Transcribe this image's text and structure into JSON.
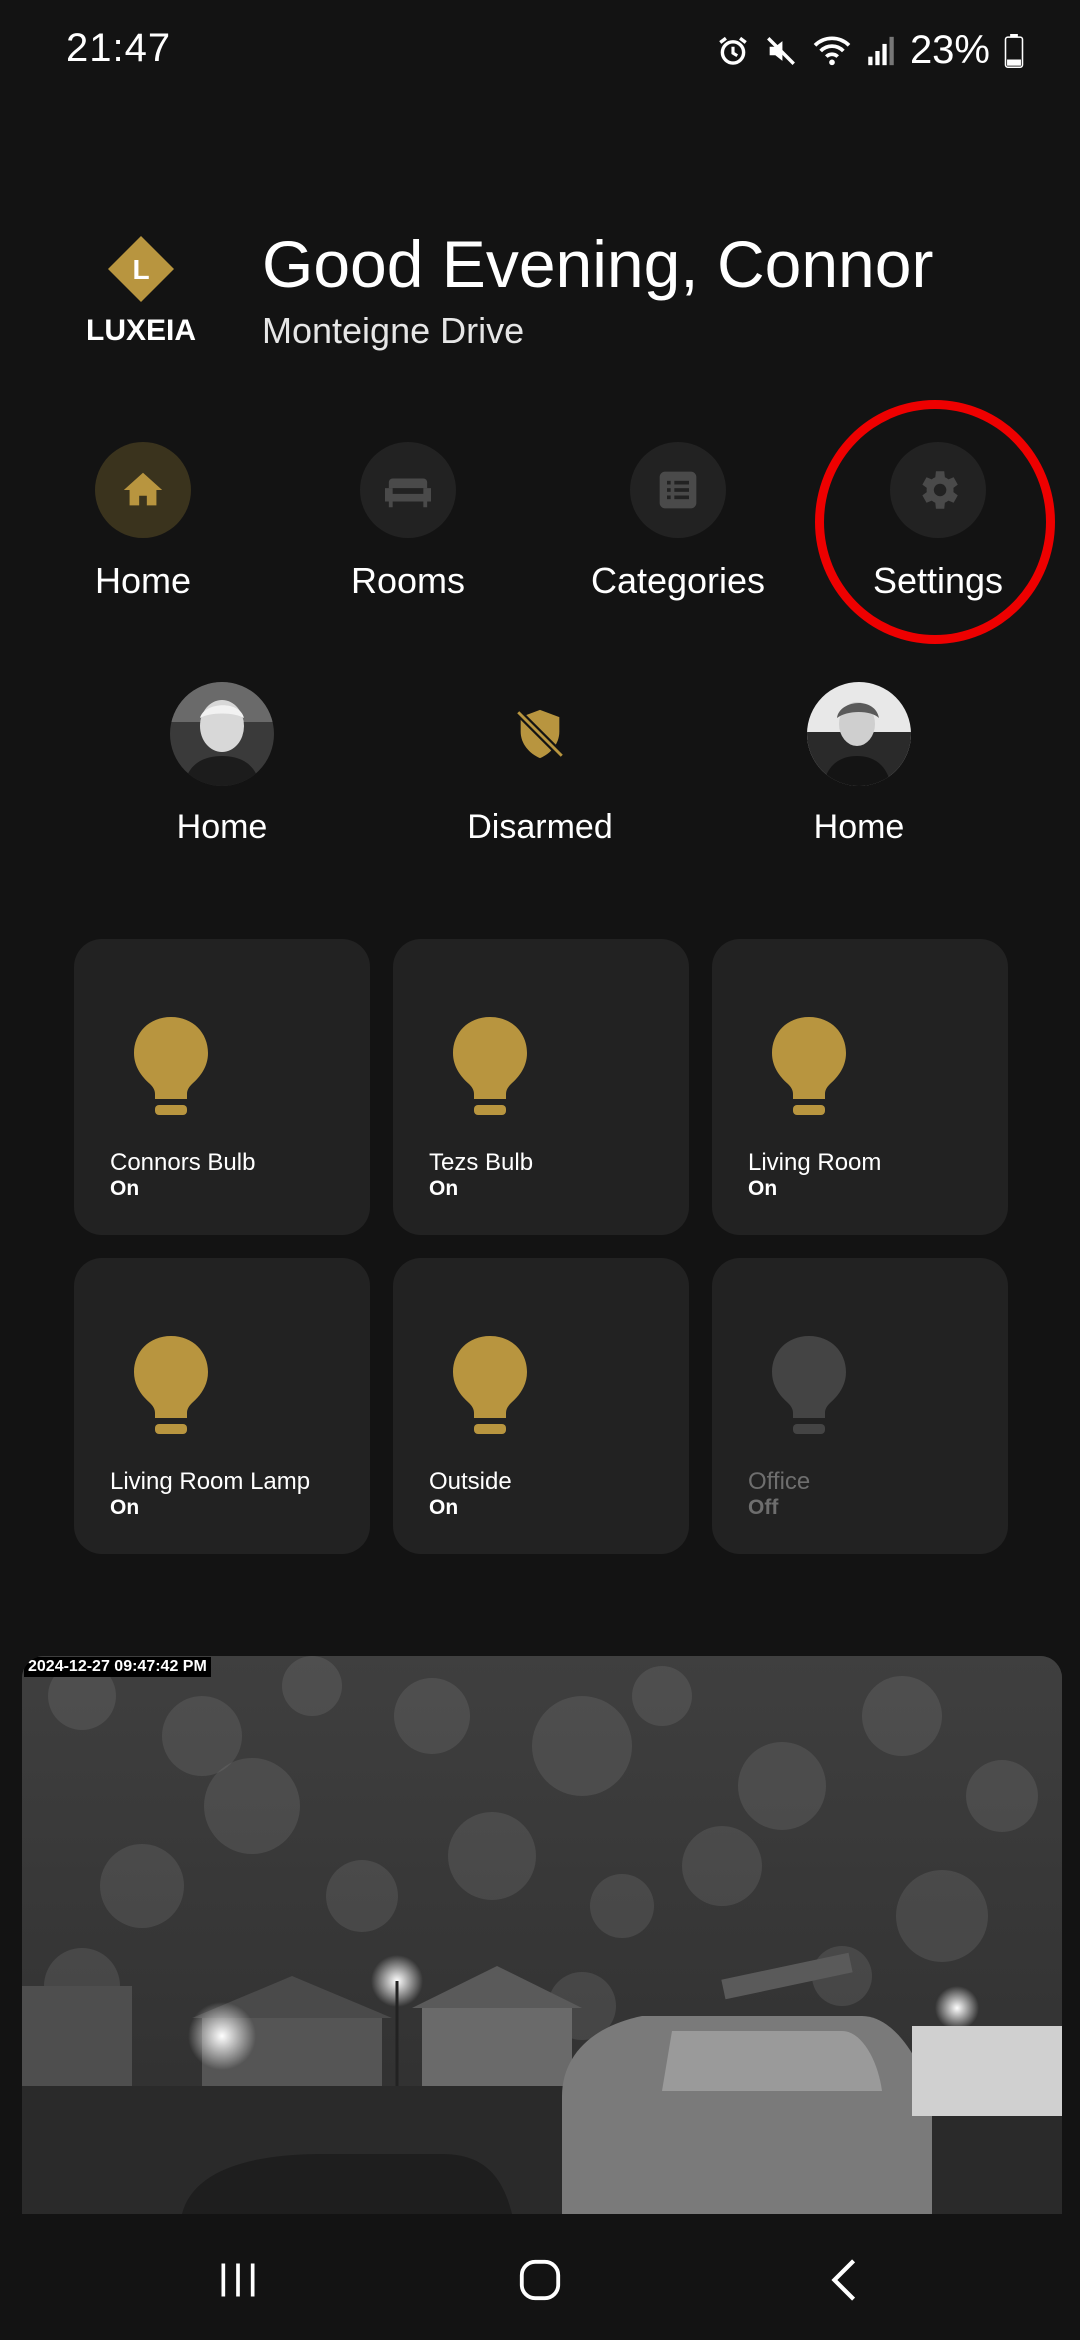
{
  "status_bar": {
    "time": "21:47",
    "battery": "23%",
    "icons": [
      "alarm-icon",
      "mute-icon",
      "wifi-icon",
      "signal-icon",
      "battery-icon"
    ]
  },
  "header": {
    "brand": "LUXEIA",
    "logo_letter": "L",
    "greeting": "Good Evening, Connor",
    "address": "Monteigne Drive"
  },
  "nav": {
    "items": [
      {
        "label": "Home",
        "icon": "home-icon",
        "active": true
      },
      {
        "label": "Rooms",
        "icon": "sofa-icon",
        "active": false
      },
      {
        "label": "Categories",
        "icon": "list-icon",
        "active": false
      },
      {
        "label": "Settings",
        "icon": "gear-icon",
        "active": false
      }
    ]
  },
  "presence": [
    {
      "label": "Home",
      "type": "person"
    },
    {
      "label": "Disarmed",
      "type": "alarm",
      "icon": "shield-off-icon"
    },
    {
      "label": "Home",
      "type": "person"
    }
  ],
  "lights": [
    {
      "name": "Connors Bulb",
      "state": "On"
    },
    {
      "name": "Tezs Bulb",
      "state": "On"
    },
    {
      "name": "Living Room",
      "state": "On"
    },
    {
      "name": "Living Room Lamp",
      "state": "On"
    },
    {
      "name": "Outside",
      "state": "On"
    },
    {
      "name": "Office",
      "state": "Off"
    }
  ],
  "camera": {
    "timestamp": "2024-12-27 09:47:42 PM"
  },
  "colors": {
    "accent": "#b8953f",
    "background": "#131313",
    "tile": "#222222",
    "highlight": "#e00000",
    "off": "#444444"
  }
}
